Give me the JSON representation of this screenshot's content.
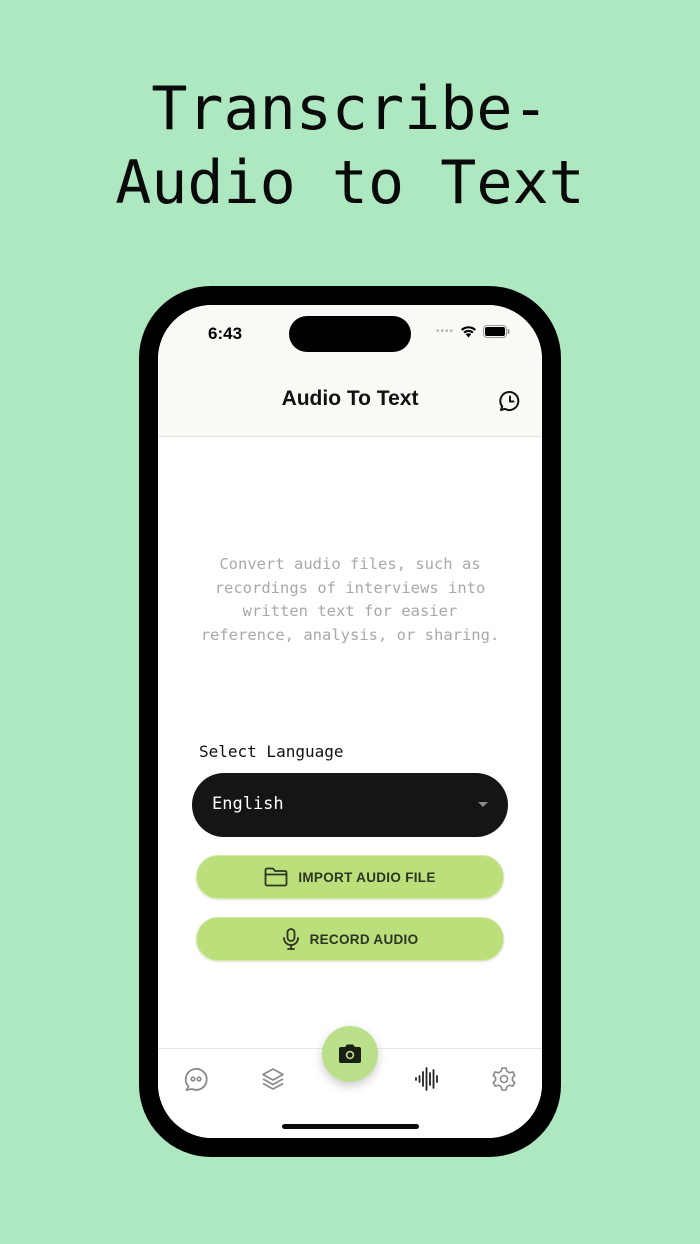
{
  "headline": {
    "line1": "Transcribe-",
    "line2": "Audio to Text"
  },
  "statusbar": {
    "time": "6:43"
  },
  "navbar": {
    "title": "Audio To Text",
    "right_icon": "history-icon"
  },
  "main": {
    "description": "Convert audio files, such as recordings of interviews into written text for easier reference, analysis, or sharing.",
    "language_label": "Select Language",
    "language_value": "English",
    "import_button": {
      "label": "IMPORT AUDIO FILE",
      "icon": "folder-icon"
    },
    "record_button": {
      "label": "RECORD AUDIO",
      "icon": "microphone-icon"
    }
  },
  "tabbar": {
    "items": [
      "chat-icon",
      "layers-icon",
      "camera-icon",
      "waveform-icon",
      "gear-icon"
    ],
    "active": "waveform-icon"
  },
  "colors": {
    "background": "#ade8c0",
    "button_green": "#bbdf7a",
    "select_bg": "#151515"
  }
}
